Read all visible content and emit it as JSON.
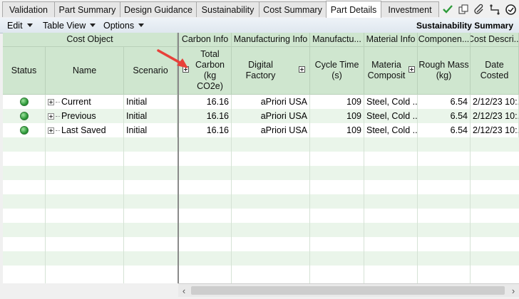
{
  "tabs": [
    {
      "label": "Validation",
      "active": false
    },
    {
      "label": "Part Summary",
      "active": false
    },
    {
      "label": "Design Guidance",
      "active": false
    },
    {
      "label": "Sustainability",
      "active": false
    },
    {
      "label": "Cost Summary",
      "active": false
    },
    {
      "label": "Part Details",
      "active": true
    },
    {
      "label": "Investment",
      "active": false
    }
  ],
  "toolbar_icons": [
    "checkmark-icon",
    "copy-icon",
    "attach-icon",
    "connector-icon",
    "refresh-icon"
  ],
  "menus": [
    {
      "label": "Edit"
    },
    {
      "label": "Table View"
    },
    {
      "label": "Options"
    }
  ],
  "view_title": "Sustainability Summary",
  "groups": {
    "cost_object": "Cost Object",
    "carbon_info": "Carbon Info",
    "manufacturing_info": "Manufacturing Info",
    "manufactu": "Manufactu...",
    "material_info": "Material Info",
    "componen": "Componen...",
    "cost_descri": "Cost Descri..."
  },
  "columns": {
    "status": "Status",
    "name": "Name",
    "scenario": "Scenario",
    "total_carbon": "Total\nCarbon\n(kg\nCO2e)",
    "digital_factory": "Digital\nFactory",
    "cycle_time": "Cycle Time\n(s)",
    "material_comp": "Materia\nComposit",
    "rough_mass": "Rough Mass\n(kg)",
    "date_costed": "Date\nCosted"
  },
  "rows": [
    {
      "status": "green",
      "name": "Current",
      "scenario": "Initial",
      "total_carbon": "16.16",
      "digital_factory": "aPriori USA",
      "cycle_time": "109",
      "material": "Steel, Cold ...",
      "rough_mass": "6.54",
      "date_costed": "2/12/23 10:..."
    },
    {
      "status": "green",
      "name": "Previous",
      "scenario": "Initial",
      "total_carbon": "16.16",
      "digital_factory": "aPriori USA",
      "cycle_time": "109",
      "material": "Steel, Cold ...",
      "rough_mass": "6.54",
      "date_costed": "2/12/23 10:..."
    },
    {
      "status": "green",
      "name": "Last Saved",
      "scenario": "Initial",
      "total_carbon": "16.16",
      "digital_factory": "aPriori USA",
      "cycle_time": "109",
      "material": "Steel, Cold ...",
      "rough_mass": "6.54",
      "date_costed": "2/12/23 10:..."
    }
  ],
  "colors": {
    "header_green": "#cfe6cf",
    "row_alt": "#eaf5ea",
    "status_green": "#2e9b3a",
    "annotation_arrow": "#e8413a"
  }
}
